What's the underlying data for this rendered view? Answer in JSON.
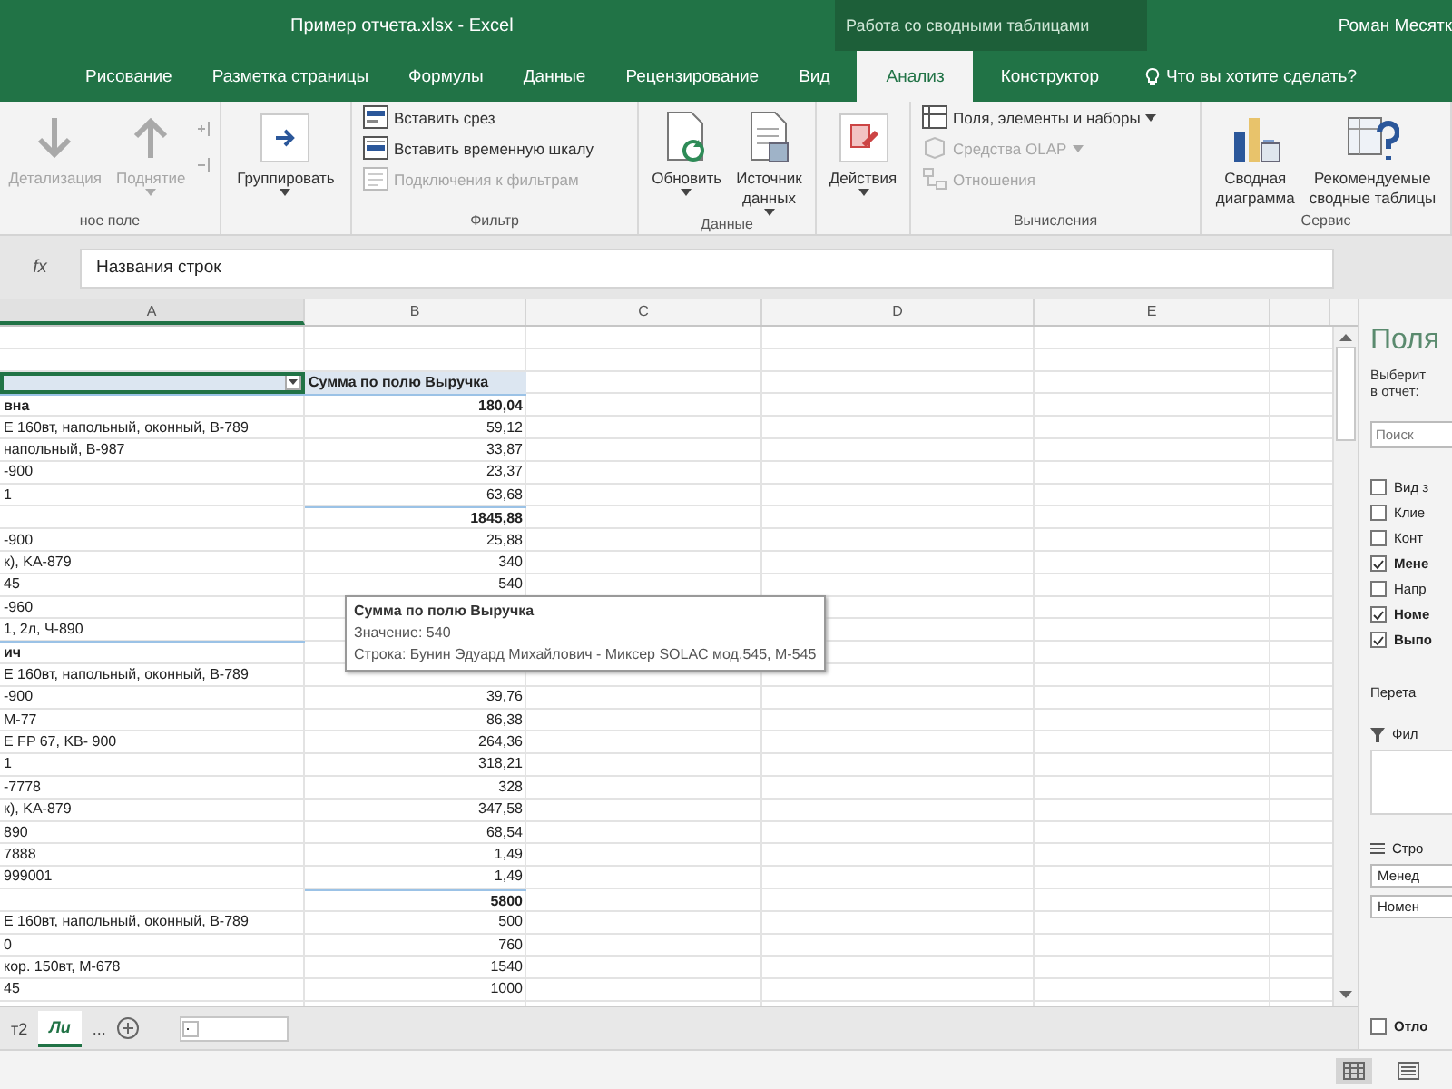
{
  "window": {
    "title": "Пример отчета.xlsx  -  Excel",
    "context_title": "Работа со сводными таблицами",
    "user": "Роман Месятк"
  },
  "tabs": [
    {
      "label": "Рисование",
      "selected": false
    },
    {
      "label": "Разметка страницы",
      "selected": false
    },
    {
      "label": "Формулы",
      "selected": false
    },
    {
      "label": "Данные",
      "selected": false
    },
    {
      "label": "Рецензирование",
      "selected": false
    },
    {
      "label": "Вид",
      "selected": false
    },
    {
      "label": "Анализ",
      "selected": true
    },
    {
      "label": "Конструктор",
      "selected": false
    }
  ],
  "tell_me": "Что вы хотите сделать?",
  "ribbon": {
    "groups": [
      {
        "label": "ное поле",
        "items": [
          {
            "kind": "large",
            "lines": [
              "Детализация"
            ],
            "disabled": true,
            "dropdown": false
          },
          {
            "kind": "large",
            "lines": [
              "Поднятие"
            ],
            "disabled": true,
            "dropdown": true
          }
        ]
      },
      {
        "items": [
          {
            "kind": "large",
            "lines": [
              "Группировать"
            ],
            "disabled": false,
            "dropdown": true
          }
        ]
      },
      {
        "label": "Фильтр",
        "items": [
          {
            "kind": "small",
            "lines": [
              "Вставить срез"
            ],
            "disabled": false,
            "dropdown": false
          },
          {
            "kind": "small",
            "lines": [
              "Вставить временную шкалу"
            ],
            "disabled": false,
            "dropdown": false
          },
          {
            "kind": "small",
            "lines": [
              "Подключения к фильтрам"
            ],
            "disabled": true,
            "dropdown": false
          }
        ]
      },
      {
        "label": "Данные",
        "items": [
          {
            "kind": "large",
            "lines": [
              "Обновить"
            ],
            "disabled": false,
            "dropdown": true
          },
          {
            "kind": "large",
            "lines": [
              "Источник",
              "данных"
            ],
            "disabled": false,
            "dropdown": true
          }
        ]
      },
      {
        "items": [
          {
            "kind": "large",
            "lines": [
              "Действия"
            ],
            "disabled": false,
            "dropdown": true
          }
        ]
      },
      {
        "label": "Вычисления",
        "items": [
          {
            "kind": "small",
            "lines": [
              "Поля, элементы и наборы"
            ],
            "disabled": false,
            "dropdown": true
          },
          {
            "kind": "small",
            "lines": [
              "Средства OLAP"
            ],
            "disabled": true,
            "dropdown": true
          },
          {
            "kind": "small",
            "lines": [
              "Отношения"
            ],
            "disabled": true,
            "dropdown": false
          }
        ]
      },
      {
        "label": "Сервис",
        "items": [
          {
            "kind": "large",
            "lines": [
              "Сводная",
              "диаграмма"
            ],
            "disabled": false,
            "dropdown": false
          },
          {
            "kind": "large",
            "lines": [
              "Рекомендуемые",
              "сводные таблицы"
            ],
            "disabled": false,
            "dropdown": false
          }
        ]
      }
    ]
  },
  "formula_bar": {
    "function_label": "fx",
    "value": "Названия строк"
  },
  "columns": [
    "A",
    "B",
    "C",
    "D",
    "E"
  ],
  "rows": [
    {
      "kind": "empty"
    },
    {
      "kind": "empty"
    },
    {
      "kind": "header",
      "value": "Сумма по полю Выручка",
      "selected": true
    },
    {
      "kind": "data",
      "label": "вна",
      "value": "180,04",
      "bold": true
    },
    {
      "kind": "data",
      "label": "E 160вт, напольный, оконный, B-789",
      "value": "59,12",
      "bold": false
    },
    {
      "kind": "data",
      "label": "напольный, B-987",
      "value": "33,87",
      "bold": false
    },
    {
      "kind": "data",
      "label": "-900",
      "value": "23,37",
      "bold": false
    },
    {
      "kind": "data",
      "label": "1",
      "value": "63,68",
      "bold": false
    },
    {
      "kind": "data",
      "value": "1845,88",
      "bold": true
    },
    {
      "kind": "data",
      "label": "-900",
      "value": "25,88",
      "bold": false
    },
    {
      "kind": "data",
      "label": "к), KA-879",
      "value": "340",
      "bold": false
    },
    {
      "kind": "data",
      "label": "45",
      "value": "540",
      "bold": false
    },
    {
      "kind": "data",
      "label": "-960",
      "bold": false
    },
    {
      "kind": "data",
      "label": "1, 2л, Ч-890",
      "bold": false
    },
    {
      "kind": "data",
      "label": "ич",
      "bold": true
    },
    {
      "kind": "data",
      "label": "E 160вт, напольный, оконный, B-789",
      "bold": false
    },
    {
      "kind": "data",
      "label": "-900",
      "value": "39,76",
      "bold": false
    },
    {
      "kind": "data",
      "label": "M-77",
      "value": "86,38",
      "bold": false
    },
    {
      "kind": "data",
      "label": "E FP 67, KB- 900",
      "value": "264,36",
      "bold": false
    },
    {
      "kind": "data",
      "label": "1",
      "value": "318,21",
      "bold": false
    },
    {
      "kind": "data",
      "label": "-7778",
      "value": "328",
      "bold": false
    },
    {
      "kind": "data",
      "label": "к), KA-879",
      "value": "347,58",
      "bold": false
    },
    {
      "kind": "data",
      "label": "890",
      "value": "68,54",
      "bold": false
    },
    {
      "kind": "data",
      "label": "7888",
      "value": "1,49",
      "bold": false
    },
    {
      "kind": "data",
      "label": "999001",
      "value": "1,49",
      "bold": false
    },
    {
      "kind": "data",
      "value": "5800",
      "bold": true
    },
    {
      "kind": "data",
      "label": "E 160вт, напольный, оконный, B-789",
      "value": "500",
      "bold": false
    },
    {
      "kind": "data",
      "label": "0",
      "value": "760",
      "bold": false
    },
    {
      "kind": "data",
      "label": "кор. 150вт, M-678",
      "value": "1540",
      "bold": false
    },
    {
      "kind": "data",
      "label": "45",
      "value": "1000",
      "bold": false
    }
  ],
  "tooltip": {
    "title": "Сумма по полю Выручка",
    "lines": [
      "Значение: 540",
      "Строка: Бунин Эдуард Михайлович - Миксер SOLAC мод.545, M-545"
    ]
  },
  "sheet_tabs": [
    {
      "label": "т2",
      "selected": false
    },
    {
      "label": "Ли",
      "selected": true
    }
  ],
  "more_sheets": "...",
  "pane": {
    "title": "Поля",
    "hint_lines": [
      "Выберит",
      "в отчет:"
    ],
    "search_placeholder": "Поиск",
    "fields": [
      {
        "label": "Вид з",
        "checked": false
      },
      {
        "label": "Клие",
        "checked": false
      },
      {
        "label": "Конт",
        "checked": false
      },
      {
        "label": "Мене",
        "checked": true
      },
      {
        "label": "Напр",
        "checked": false
      },
      {
        "label": "Номе",
        "checked": true
      },
      {
        "label": "Выпо",
        "checked": true
      }
    ],
    "drag_hint": "Перета",
    "areas": [
      {
        "kind": "filters",
        "label": "Фил"
      },
      {
        "kind": "rows",
        "label": "Стро",
        "items": [
          "Менед",
          "Номен"
        ]
      }
    ],
    "defer": {
      "label": "Отло",
      "checked": false
    }
  }
}
